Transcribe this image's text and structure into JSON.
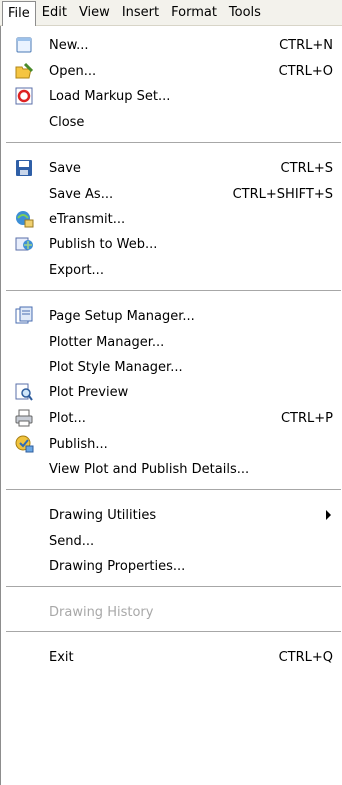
{
  "menubar": [
    "File",
    "Edit",
    "View",
    "Insert",
    "Format",
    "Tools"
  ],
  "file_menu": {
    "items": [
      {
        "label": "New...",
        "shortcut": "CTRL+N",
        "icon": "new-document-icon"
      },
      {
        "label": "Open...",
        "shortcut": "CTRL+O",
        "icon": "open-folder-icon"
      },
      {
        "label": "Load Markup Set...",
        "shortcut": "",
        "icon": "markup-set-icon"
      },
      {
        "label": "Close",
        "shortcut": ""
      },
      {
        "label": "Save",
        "shortcut": "CTRL+S",
        "icon": "floppy-disk-icon"
      },
      {
        "label": "Save As...",
        "shortcut": "CTRL+SHIFT+S"
      },
      {
        "label": "eTransmit...",
        "shortcut": "",
        "icon": "etransmit-icon"
      },
      {
        "label": "Publish to Web...",
        "shortcut": "",
        "icon": "publish-web-icon"
      },
      {
        "label": "Export...",
        "shortcut": ""
      },
      {
        "label": "Page Setup Manager...",
        "shortcut": "",
        "icon": "page-setup-icon"
      },
      {
        "label": "Plotter Manager...",
        "shortcut": ""
      },
      {
        "label": "Plot Style Manager...",
        "shortcut": ""
      },
      {
        "label": "Plot Preview",
        "shortcut": "",
        "icon": "plot-preview-icon"
      },
      {
        "label": "Plot...",
        "shortcut": "CTRL+P",
        "icon": "printer-icon"
      },
      {
        "label": "Publish...",
        "shortcut": "",
        "icon": "publish-icon"
      },
      {
        "label": "View Plot and Publish Details...",
        "shortcut": ""
      },
      {
        "label": "Drawing Utilities",
        "shortcut": "",
        "submenu": true
      },
      {
        "label": "Send...",
        "shortcut": ""
      },
      {
        "label": "Drawing Properties...",
        "shortcut": ""
      },
      {
        "label": "Drawing History",
        "shortcut": "",
        "disabled": true
      },
      {
        "label": "Exit",
        "shortcut": "CTRL+Q"
      }
    ]
  },
  "colors": {
    "menubar_bg": "#f3f2ec",
    "separator": "#a7a7a7",
    "disabled_text": "#a8a8a8"
  }
}
